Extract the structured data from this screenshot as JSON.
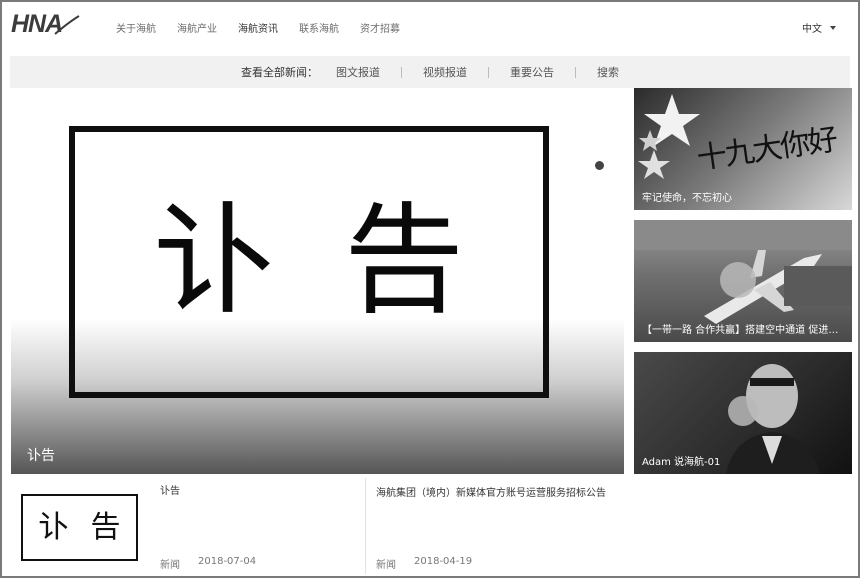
{
  "header": {
    "logo_text": "HNA",
    "nav": [
      {
        "label": "关于海航",
        "active": false
      },
      {
        "label": "海航产业",
        "active": false
      },
      {
        "label": "海航资讯",
        "active": true
      },
      {
        "label": "联系海航",
        "active": false
      },
      {
        "label": "资才招募",
        "active": false
      }
    ],
    "language": "中文"
  },
  "subnav": {
    "title": "查看全部新闻：",
    "items": [
      "图文报道",
      "视频报道",
      "重要公告",
      "搜索"
    ]
  },
  "hero": {
    "card_text": [
      "讣",
      "告"
    ],
    "caption": "讣告",
    "slide_count": 2,
    "active_slide": 1
  },
  "side_news": [
    {
      "caption": "牢记使命，不忘初心",
      "image_text": "十九大你好"
    },
    {
      "caption": "【一带一路 合作共赢】搭建空中通道 促进民心相通"
    },
    {
      "caption": "Adam 说海航-01"
    }
  ],
  "news_list": [
    {
      "thumb_text": [
        "讣",
        "告"
      ],
      "title": "讣告",
      "category": "新闻",
      "date": "2018-07-04"
    },
    {
      "title": "海航集团（境内）新媒体官方账号运营服务招标公告",
      "category": "新闻",
      "date": "2018-04-19"
    }
  ],
  "colors": {
    "subnav_bg": "#f1f1f1",
    "text_primary": "#333333",
    "text_secondary": "#777777"
  }
}
